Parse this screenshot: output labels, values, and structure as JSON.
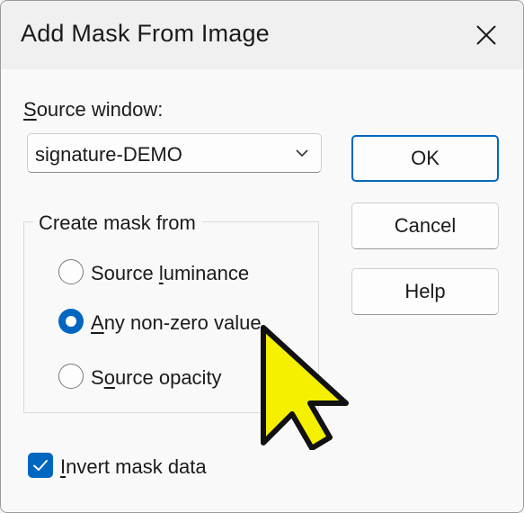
{
  "dialog": {
    "title": "Add Mask From Image",
    "close_icon": "close-icon"
  },
  "source_window": {
    "label_prefix": "",
    "label_underlined": "S",
    "label_rest": "ource window:",
    "selected_value": "signature-DEMO",
    "dropdown_icon": "chevron-down-icon"
  },
  "group": {
    "title": "Create mask from",
    "options": [
      {
        "prefix": "Source ",
        "underlined": "l",
        "rest": "uminance",
        "checked": false
      },
      {
        "prefix": "",
        "underlined": "A",
        "rest": "ny non-zero value",
        "checked": true
      },
      {
        "prefix": "S",
        "underlined": "o",
        "rest": "urce opacity",
        "checked": false
      }
    ]
  },
  "invert": {
    "prefix": "",
    "underlined": "I",
    "rest": "nvert mask data",
    "checked": true
  },
  "buttons": {
    "ok": "OK",
    "cancel": "Cancel",
    "help": "Help"
  },
  "colors": {
    "accent": "#0067c0",
    "cursor_fill": "#f5f000"
  }
}
